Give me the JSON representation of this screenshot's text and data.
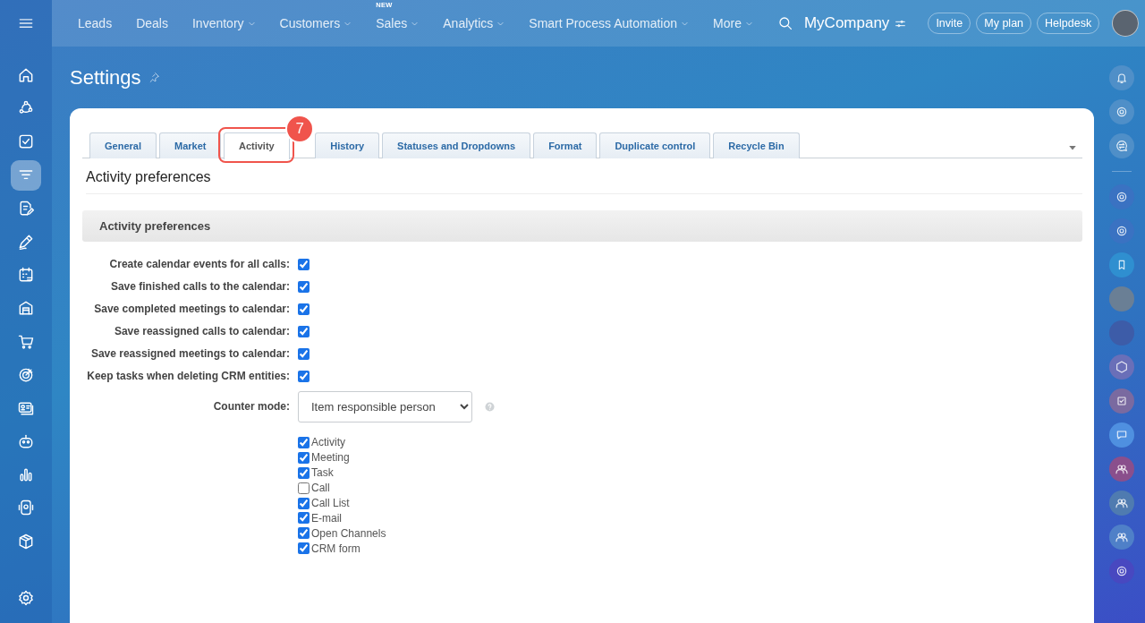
{
  "topbar": {
    "nav": [
      {
        "label": "Leads",
        "menu": false
      },
      {
        "label": "Deals",
        "menu": false
      },
      {
        "label": "Inventory",
        "menu": true
      },
      {
        "label": "Customers",
        "menu": true
      },
      {
        "label": "Sales",
        "menu": true,
        "badge": "NEW"
      },
      {
        "label": "Analytics",
        "menu": true
      },
      {
        "label": "Smart Process Automation",
        "menu": true
      },
      {
        "label": "More",
        "menu": true
      }
    ],
    "company": "MyCompany",
    "buttons": [
      "Invite",
      "My plan",
      "Helpdesk"
    ]
  },
  "sidebar": {
    "items": [
      {
        "selected": false
      },
      {
        "selected": false
      },
      {
        "selected": false
      },
      {
        "selected": true
      },
      {
        "selected": false
      },
      {
        "selected": false
      },
      {
        "selected": false
      },
      {
        "selected": false
      },
      {
        "selected": false
      },
      {
        "selected": false
      },
      {
        "selected": false
      },
      {
        "selected": false
      },
      {
        "selected": false
      },
      {
        "selected": false
      },
      {
        "selected": false
      }
    ]
  },
  "page": {
    "title": "Settings"
  },
  "tabs": [
    {
      "label": "General",
      "selected": false
    },
    {
      "label": "Market",
      "selected": false
    },
    {
      "label": "Activity",
      "selected": true,
      "callout": "7"
    },
    {
      "label": "History",
      "selected": false
    },
    {
      "label": "Statuses and Dropdowns",
      "selected": false
    },
    {
      "label": "Format",
      "selected": false
    },
    {
      "label": "Duplicate control",
      "selected": false
    },
    {
      "label": "Recycle Bin",
      "selected": false
    }
  ],
  "heading": "Activity preferences",
  "section": "Activity preferences",
  "rows": [
    {
      "kind": "checkbox",
      "label": "Create calendar events for all calls:",
      "checked": true
    },
    {
      "kind": "checkbox",
      "label": "Save finished calls to the calendar:",
      "checked": true
    },
    {
      "kind": "checkbox",
      "label": "Save completed meetings to calendar:",
      "checked": true
    },
    {
      "kind": "checkbox",
      "label": "Save reassigned calls to calendar:",
      "checked": true
    },
    {
      "kind": "checkbox",
      "label": "Save reassigned meetings to calendar:",
      "checked": true
    },
    {
      "kind": "checkbox",
      "label": "Keep tasks when deleting CRM entities:",
      "checked": true
    },
    {
      "kind": "select",
      "label": "Counter mode:",
      "value": "Item responsible person"
    }
  ],
  "options": [
    {
      "label": "Activity",
      "checked": true
    },
    {
      "label": "Meeting",
      "checked": true
    },
    {
      "label": "Task",
      "checked": true
    },
    {
      "label": "Call",
      "checked": false
    },
    {
      "label": "Call List",
      "checked": true
    },
    {
      "label": "E-mail",
      "checked": true
    },
    {
      "label": "Open Channels",
      "checked": true
    },
    {
      "label": "CRM form",
      "checked": true
    }
  ]
}
